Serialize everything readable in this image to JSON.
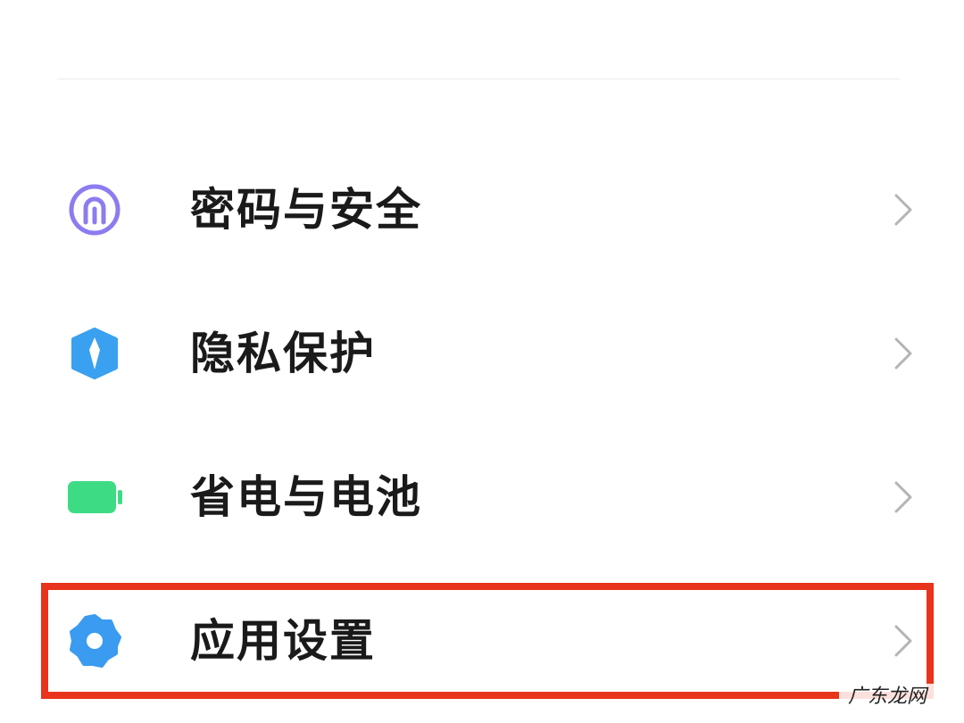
{
  "settings": {
    "items": [
      {
        "label": "密码与安全",
        "icon": "fingerprint-icon",
        "icon_color": "#8b7cf0"
      },
      {
        "label": "隐私保护",
        "icon": "privacy-shield-icon",
        "icon_color": "#3aa0f0"
      },
      {
        "label": "省电与电池",
        "icon": "battery-icon",
        "icon_color": "#3ddc84"
      },
      {
        "label": "应用设置",
        "icon": "gear-icon",
        "icon_color": "#3a9bf0"
      }
    ]
  },
  "highlight": {
    "color": "#e8341c",
    "target": "应用设置"
  },
  "watermark": {
    "text": "广东龙网"
  }
}
